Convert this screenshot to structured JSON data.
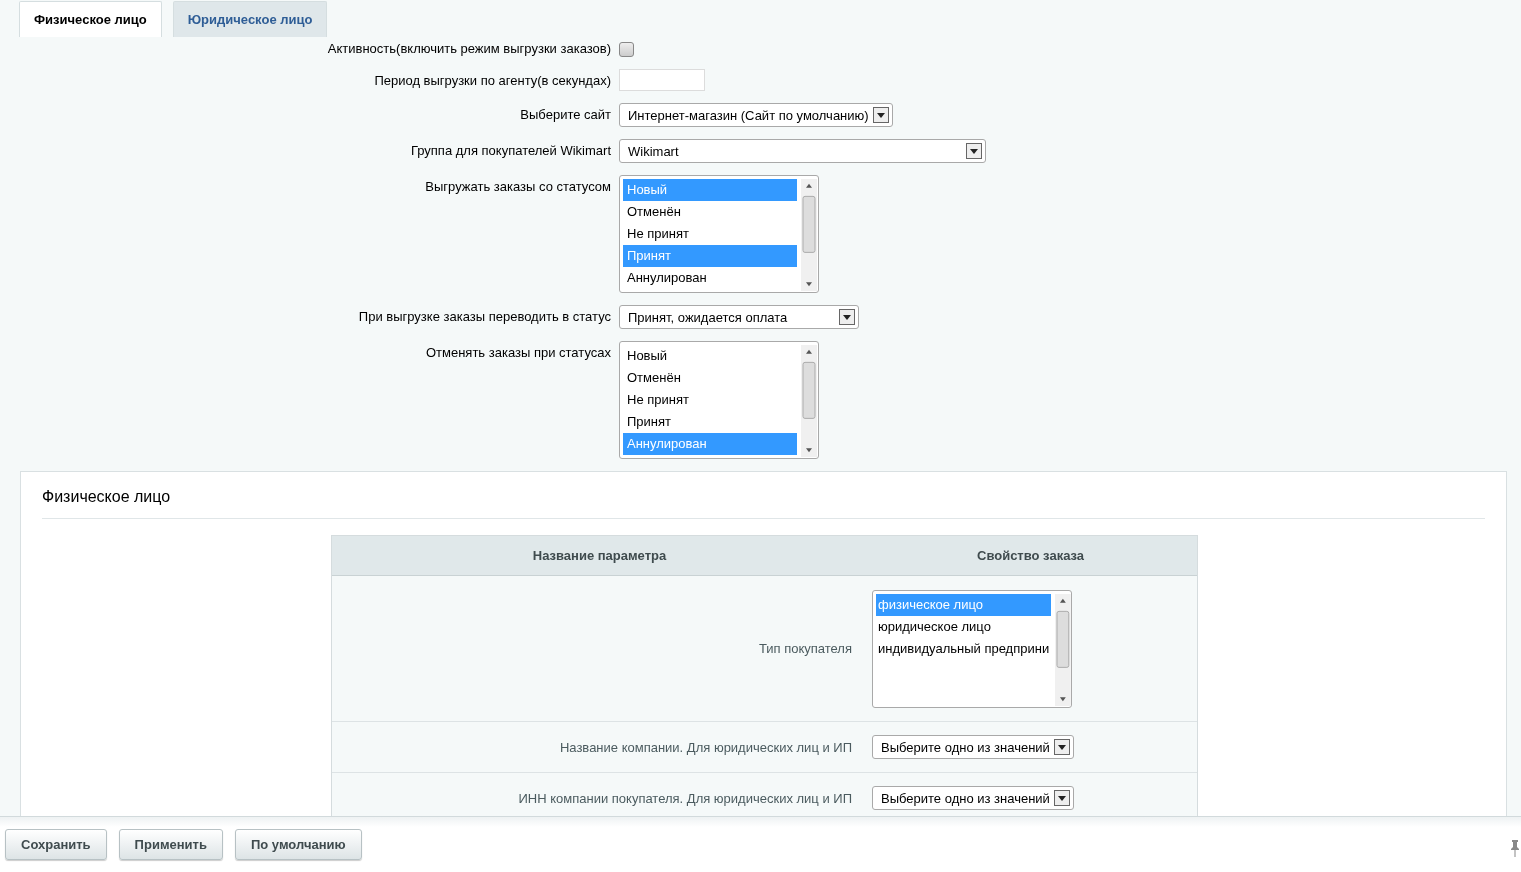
{
  "tabs": [
    {
      "label": "Физическое лицо",
      "selected": true
    },
    {
      "label": "Юридическое лицо",
      "selected": false
    }
  ],
  "settings": [
    {
      "kind": "checkbox",
      "label": "Активность(включить режим выгрузки заказов)",
      "checked": false
    },
    {
      "kind": "text",
      "label": "Период выгрузки по агенту(в секундах)"
    },
    {
      "kind": "select",
      "label": "Выберите сайт",
      "value": "Интернет-магазин (Сайт по умолчанию)"
    },
    {
      "kind": "select",
      "label": "Группа для покупателей Wikimart",
      "value": "Wikimart"
    },
    {
      "kind": "listbox",
      "label": "Выгружать заказы со статусом",
      "options": [
        {
          "label": "Новый",
          "selected": true
        },
        {
          "label": "Отменён",
          "selected": false
        },
        {
          "label": "Не принят",
          "selected": false
        },
        {
          "label": "Принят",
          "selected": true
        },
        {
          "label": "Аннулирован",
          "selected": false
        }
      ]
    },
    {
      "kind": "select",
      "label": "При выгрузке заказы переводить в статус",
      "value": "Принят, ожидается оплата"
    },
    {
      "kind": "listbox",
      "label": "Отменять заказы при статусах",
      "options": [
        {
          "label": "Новый",
          "selected": false
        },
        {
          "label": "Отменён",
          "selected": false
        },
        {
          "label": "Не принят",
          "selected": false
        },
        {
          "label": "Принят",
          "selected": false
        },
        {
          "label": "Аннулирован",
          "selected": true
        }
      ]
    }
  ],
  "section": {
    "title": "Физическое лицо",
    "columns": [
      "Название параметра",
      "Свойство заказа"
    ],
    "rows": [
      {
        "kind": "listbox",
        "label": "Тип покупателя",
        "options": [
          {
            "label": "физическое лицо",
            "selected": true
          },
          {
            "label": "юридическое лицо",
            "selected": false
          },
          {
            "label": "индивидуальный предприни",
            "selected": false
          }
        ]
      },
      {
        "kind": "select",
        "label": "Название компании. Для юридических лиц и ИП",
        "value": "Выберите одно из значений"
      },
      {
        "kind": "select",
        "label": "ИНН компании покупателя. Для юридических лиц и ИП",
        "value": "Выберите одно из значений"
      }
    ]
  },
  "buttons": [
    "Сохранить",
    "Применить",
    "По умолчанию"
  ]
}
